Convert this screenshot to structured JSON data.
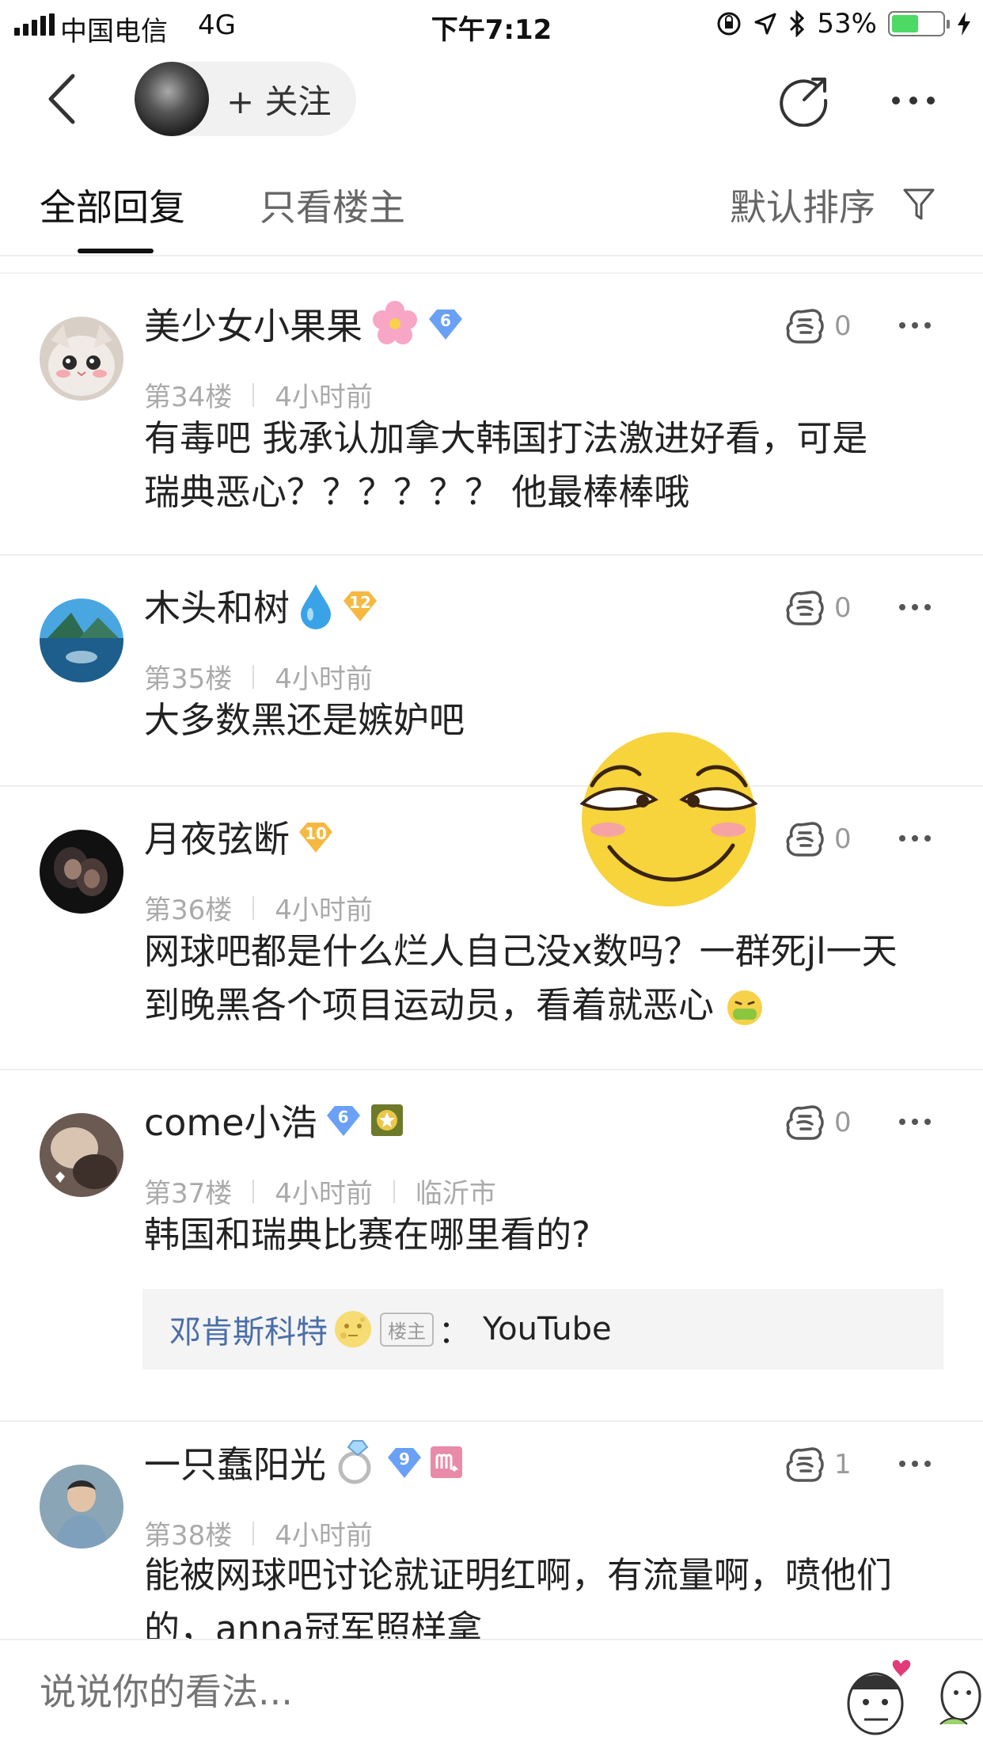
{
  "status_bar": {
    "carrier": "中国电信",
    "network": "4G",
    "time": "下午7:12",
    "battery": "53%",
    "battery_level": 0.53
  },
  "header": {
    "follow_label": "+ 关注"
  },
  "tabs": {
    "all": "全部回复",
    "op_only": "只看楼主",
    "sort": "默认排序"
  },
  "comments": [
    {
      "username": "美少女小果果",
      "level": "6",
      "floor": "第34楼",
      "time": "4小时前",
      "likes": "0",
      "text_line1": "有毒吧 我承认加拿大韩国打法激进好看，可是",
      "text_line2": "瑞典恶心？？？？？？ 他最棒棒哦"
    },
    {
      "username": "木头和树",
      "level": "12",
      "floor": "第35楼",
      "time": "4小时前",
      "likes": "0",
      "text_line1": "大多数黑还是嫉妒吧"
    },
    {
      "username": "月夜弦断",
      "level": "10",
      "floor": "第36楼",
      "time": "4小时前",
      "likes": "0",
      "text_line1": "网球吧都是什么烂人自己没x数吗？一群死jl一天",
      "text_line2": "到晚黑各个项目运动员，看着就恶心"
    },
    {
      "username": "come小浩",
      "level": "6",
      "floor": "第37楼",
      "time": "4小时前",
      "location": "临沂市",
      "likes": "0",
      "text_line1": "韩国和瑞典比赛在哪里看的?",
      "reply": {
        "name": "邓肯斯科特",
        "tag": "楼主",
        "colon": "：",
        "text": "YouTube"
      }
    },
    {
      "username": "一只蠢阳光",
      "level": "9",
      "floor": "第38楼",
      "time": "4小时前",
      "likes": "1",
      "text_line1": "能被网球吧讨论就证明红啊，有流量啊，喷他们",
      "text_line2": "的，anna冠军照样拿"
    }
  ],
  "bottom_bar": {
    "placeholder": "说说你的看法..."
  },
  "colors": {
    "link_blue": "#4a6ea8",
    "diamond_blue": "#6aa0f5",
    "gold": "#f5b942",
    "battery_green": "#4cd964"
  }
}
